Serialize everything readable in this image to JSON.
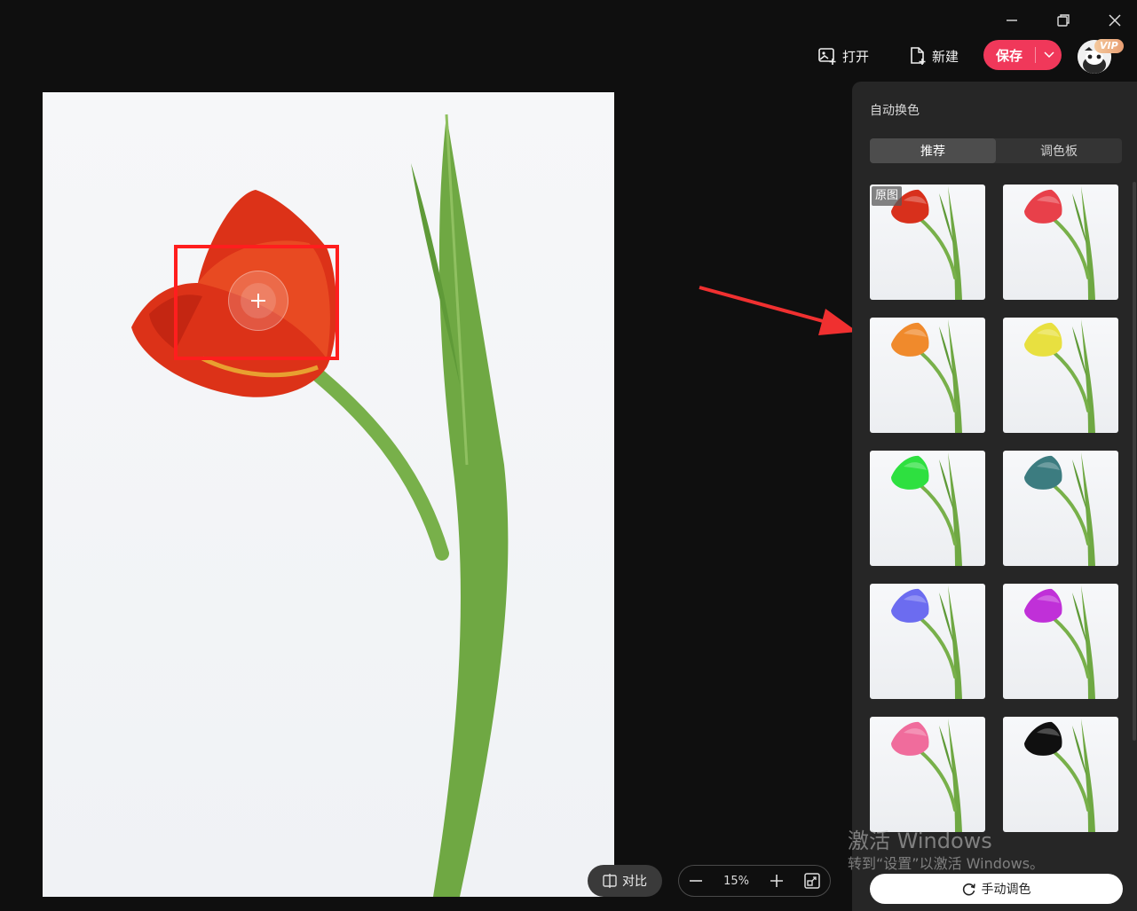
{
  "window": {
    "minimize_icon": "minimize-icon",
    "restore_icon": "restore-icon",
    "close_icon": "close-icon"
  },
  "toolbar": {
    "open_label": "打开",
    "new_label": "新建",
    "save_label": "保存",
    "vip_badge": "VIP"
  },
  "panel": {
    "title": "自动换色",
    "tabs": [
      {
        "label": "推荐",
        "active": true
      },
      {
        "label": "调色板",
        "active": false
      }
    ],
    "thumbnails": [
      {
        "label": "原图",
        "color": "#d8301c"
      },
      {
        "color": "#e8404a"
      },
      {
        "color": "#f08a2c"
      },
      {
        "color": "#e8e040"
      },
      {
        "color": "#2ee040"
      },
      {
        "color": "#3c7c80"
      },
      {
        "color": "#6c6cf0"
      },
      {
        "color": "#c030d8"
      },
      {
        "color": "#f06c9c"
      },
      {
        "color": "#101010"
      }
    ],
    "manual_label": "手动调色"
  },
  "bottom": {
    "compare_label": "对比",
    "zoom_level": "15%"
  },
  "watermark": {
    "line1": "激活 Windows",
    "line2": "转到“设置”以激活 Windows。"
  },
  "colors": {
    "accent": "#f0385a",
    "selection": "#ff1e1e",
    "arrow": "#f03030"
  }
}
